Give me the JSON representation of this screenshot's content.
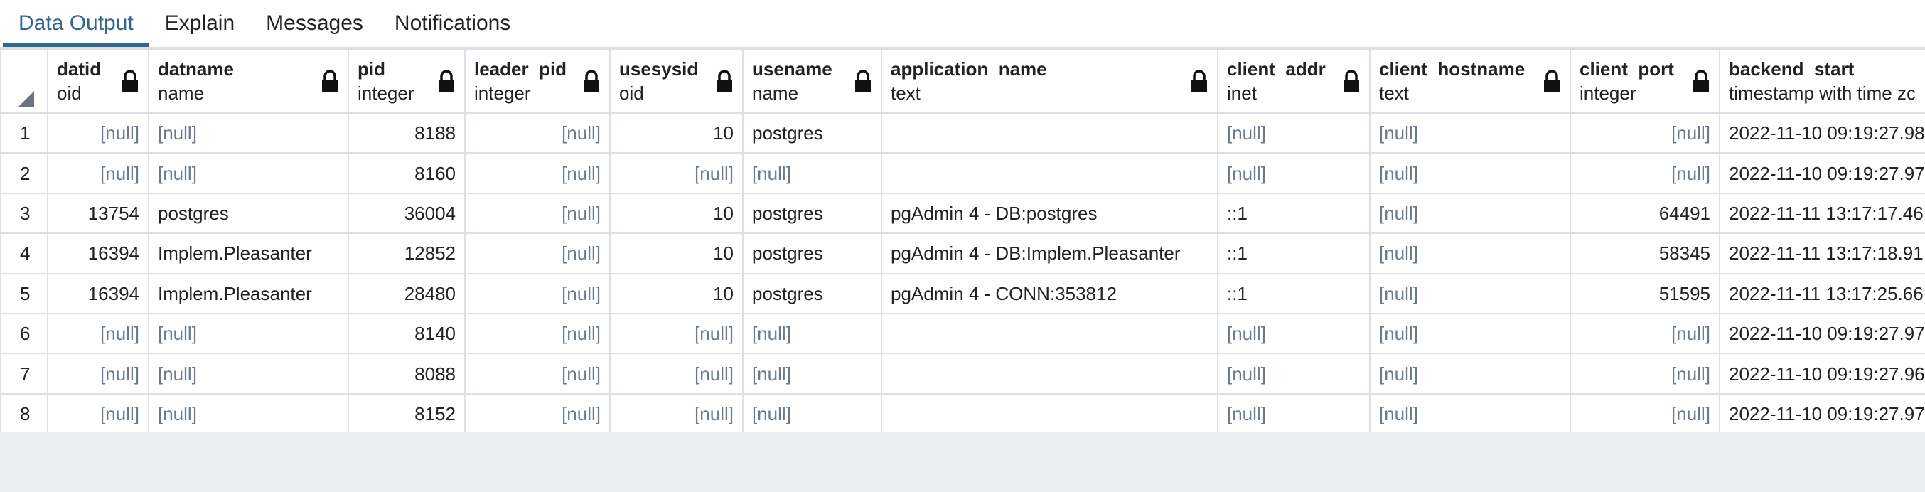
{
  "tabs": [
    {
      "label": "Data Output",
      "active": true
    },
    {
      "label": "Explain",
      "active": false
    },
    {
      "label": "Messages",
      "active": false
    },
    {
      "label": "Notifications",
      "active": false
    }
  ],
  "columns": [
    {
      "name": "datid",
      "type": "oid"
    },
    {
      "name": "datname",
      "type": "name"
    },
    {
      "name": "pid",
      "type": "integer"
    },
    {
      "name": "leader_pid",
      "type": "integer"
    },
    {
      "name": "usesysid",
      "type": "oid"
    },
    {
      "name": "usename",
      "type": "name"
    },
    {
      "name": "application_name",
      "type": "text"
    },
    {
      "name": "client_addr",
      "type": "inet"
    },
    {
      "name": "client_hostname",
      "type": "text"
    },
    {
      "name": "client_port",
      "type": "integer"
    },
    {
      "name": "backend_start",
      "type": "timestamp with time zc"
    }
  ],
  "rows": [
    {
      "num": "1",
      "cells": [
        "[null]",
        "[null]",
        "8188",
        "[null]",
        "10",
        "postgres",
        "",
        "[null]",
        "[null]",
        "[null]",
        "2022-11-10 09:19:27.98"
      ]
    },
    {
      "num": "2",
      "cells": [
        "[null]",
        "[null]",
        "8160",
        "[null]",
        "[null]",
        "[null]",
        "",
        "[null]",
        "[null]",
        "[null]",
        "2022-11-10 09:19:27.97"
      ]
    },
    {
      "num": "3",
      "cells": [
        "13754",
        "postgres",
        "36004",
        "[null]",
        "10",
        "postgres",
        "pgAdmin 4 - DB:postgres",
        "::1",
        "[null]",
        "64491",
        "2022-11-11 13:17:17.46"
      ]
    },
    {
      "num": "4",
      "cells": [
        "16394",
        "Implem.Pleasanter",
        "12852",
        "[null]",
        "10",
        "postgres",
        "pgAdmin 4 - DB:Implem.Pleasanter",
        "::1",
        "[null]",
        "58345",
        "2022-11-11 13:17:18.91"
      ]
    },
    {
      "num": "5",
      "cells": [
        "16394",
        "Implem.Pleasanter",
        "28480",
        "[null]",
        "10",
        "postgres",
        "pgAdmin 4 - CONN:353812",
        "::1",
        "[null]",
        "51595",
        "2022-11-11 13:17:25.66"
      ]
    },
    {
      "num": "6",
      "cells": [
        "[null]",
        "[null]",
        "8140",
        "[null]",
        "[null]",
        "[null]",
        "",
        "[null]",
        "[null]",
        "[null]",
        "2022-11-10 09:19:27.97"
      ]
    },
    {
      "num": "7",
      "cells": [
        "[null]",
        "[null]",
        "8088",
        "[null]",
        "[null]",
        "[null]",
        "",
        "[null]",
        "[null]",
        "[null]",
        "2022-11-10 09:19:27.96"
      ]
    },
    {
      "num": "8",
      "cells": [
        "[null]",
        "[null]",
        "8152",
        "[null]",
        "[null]",
        "[null]",
        "",
        "[null]",
        "[null]",
        "[null]",
        "2022-11-10 09:19:27.97"
      ]
    }
  ],
  "colors": {
    "accent": "#326690",
    "null_text": "#6b7a8c",
    "grid_line": "#dde0e6",
    "empty_area": "#ebeef3"
  }
}
